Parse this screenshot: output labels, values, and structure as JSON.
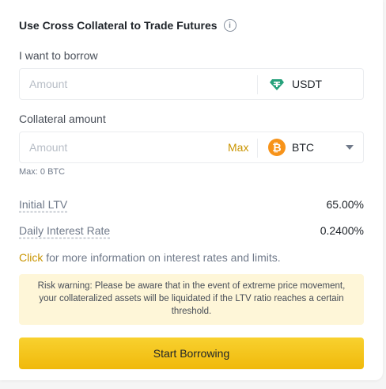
{
  "header": {
    "title": "Use Cross Collateral to Trade Futures",
    "info_icon": "info-icon"
  },
  "borrow": {
    "label": "I want to borrow",
    "placeholder": "Amount",
    "coin": "USDT",
    "coin_icon": "tether-icon"
  },
  "collateral": {
    "label": "Collateral amount",
    "placeholder": "Amount",
    "max_label": "Max",
    "coin": "BTC",
    "coin_icon": "bitcoin-icon",
    "max_note": "Max: 0 BTC"
  },
  "stats": [
    {
      "label": "Initial LTV",
      "value": "65.00%"
    },
    {
      "label": "Daily Interest Rate",
      "value": "0.2400%"
    }
  ],
  "info": {
    "link": "Click",
    "text": " for more information on interest rates and limits."
  },
  "risk_warning": "Risk warning: Please be aware that in the event of extreme price movement, your collateralized assets will be liquidated if the LTV ratio reaches a certain threshold.",
  "submit_label": "Start Borrowing",
  "colors": {
    "accent": "#f0b90b",
    "link": "#c99400",
    "warning_bg": "#fef6d8",
    "usdt": "#26a17b",
    "btc": "#f7931a"
  }
}
